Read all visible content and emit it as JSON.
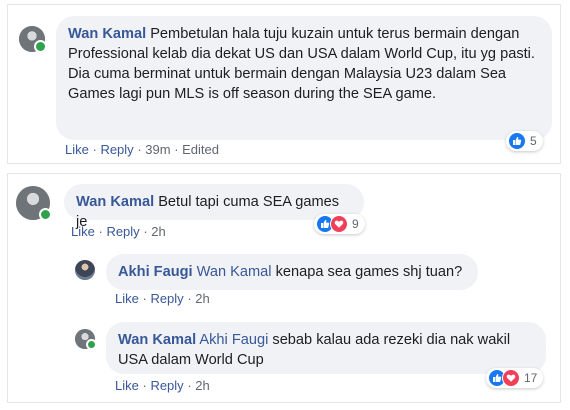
{
  "comment1": {
    "author": "Wan Kamal",
    "text": "Pembetulan hala tuju kuzain untuk terus bermain dengan Professional kelab dia dekat US dan USA dalam World Cup, itu yg pasti. Dia cuma berminat untuk bermain dengan Malaysia U23 dalam Sea Games lagi pun MLS is off season during the SEA game.",
    "actions": {
      "like": "Like",
      "reply": "Reply",
      "time": "39m",
      "edited": "Edited"
    },
    "reactions": {
      "count": "5"
    }
  },
  "comment2": {
    "author": "Wan Kamal",
    "text": "Betul tapi cuma SEA games je",
    "actions": {
      "like": "Like",
      "reply": "Reply",
      "time": "2h"
    },
    "reactions": {
      "count": "9"
    }
  },
  "reply1": {
    "author": "Akhi Faugi",
    "tag": "Wan Kamal",
    "text": "kenapa sea games shj tuan?",
    "actions": {
      "like": "Like",
      "reply": "Reply",
      "time": "2h"
    }
  },
  "reply2": {
    "author": "Wan Kamal",
    "tag": "Akhi Faugi",
    "text": "sebab kalau ada rezeki dia nak wakil USA dalam World Cup",
    "actions": {
      "like": "Like",
      "reply": "Reply",
      "time": "2h"
    },
    "reactions": {
      "count": "17"
    }
  },
  "colors": {
    "link": "#385898",
    "bubble": "#f0f2f5",
    "like": "#1877f2",
    "love": "#f33e58",
    "online": "#31a24c"
  },
  "icons": {
    "like": "thumbs-up-icon",
    "love": "heart-icon"
  }
}
